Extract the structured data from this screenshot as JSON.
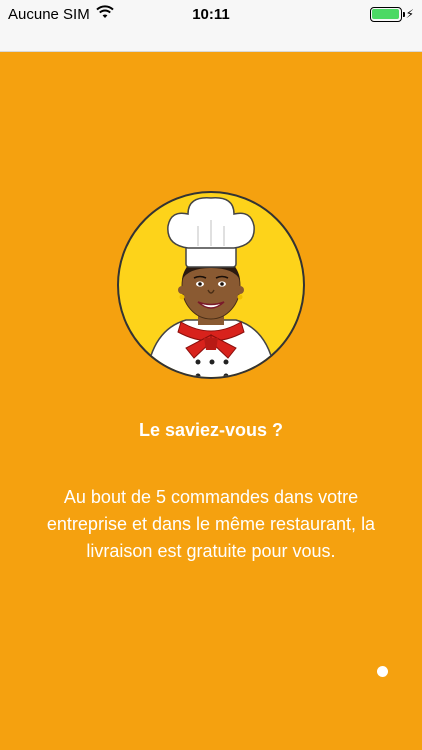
{
  "status_bar": {
    "carrier": "Aucune SIM",
    "time": "10:11",
    "wifi_icon": "wifi-icon",
    "battery_icon": "battery-icon",
    "charging_icon": "charging-bolt-icon"
  },
  "colors": {
    "background": "#f5a10f",
    "avatar_circle": "#fdd31a",
    "text": "#ffffff"
  },
  "onboarding": {
    "title": "Le saviez-vous ?",
    "body": "Au bout de 5 commandes dans votre entreprise et dans le même restaurant, la livraison est gratuite pour vous.",
    "pages_total": 1,
    "current_page": 1
  }
}
